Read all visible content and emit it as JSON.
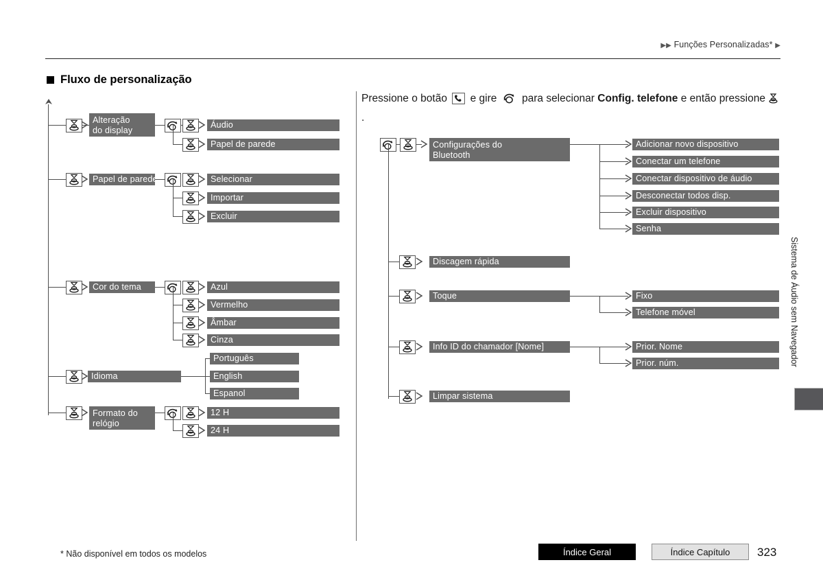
{
  "header": {
    "breadcrumb": "Funções Personalizadas*",
    "triangles": "▶▶",
    "triangle_end": "▶"
  },
  "section": {
    "title": "Fluxo de personalização"
  },
  "side_tab_label": "Sistema de Áudio sem Navegador",
  "footer": {
    "footnote": "* Não disponível em todos os modelos",
    "index_general": "Índice Geral",
    "index_chapter": "Índice Capítulo",
    "page_number": "323"
  },
  "instruction": {
    "part1": "Pressione o botão",
    "part2": "e gire",
    "part3": "para selecionar",
    "bold": "Config. telefone",
    "part4": "e então",
    "part5": "pressione",
    "period": "."
  },
  "icons": {
    "knob_rotate": "rotary-knob-icon",
    "knob_press": "press-knob-icon",
    "phone": "phone-handset-icon"
  },
  "colors": {
    "bar": "#6b6b6b",
    "line": "#4d4d4d",
    "tab": "#57575a",
    "index_general_bg": "#000000",
    "index_chapter_bg": "#e2e2e2"
  },
  "left_tree": [
    {
      "label_lines": [
        "Alteração",
        "do display"
      ],
      "children": [
        "Áudio",
        "Papel de parede"
      ]
    },
    {
      "label_lines": [
        "Papel de parede"
      ],
      "children": [
        "Selecionar",
        "Importar",
        "Excluir"
      ]
    },
    {
      "label_lines": [
        "Cor do tema"
      ],
      "children": [
        "Azul",
        "Vermelho",
        "Âmbar",
        "Cinza"
      ]
    },
    {
      "label_lines": [
        "Idioma"
      ],
      "children": [
        "Português",
        "English",
        "Espanol"
      ]
    },
    {
      "label_lines": [
        "Formato do",
        "relógio"
      ],
      "children": [
        "12 H",
        "24 H"
      ]
    }
  ],
  "right_tree": [
    {
      "label_lines": [
        "Configurações do",
        "Bluetooth"
      ],
      "children": [
        "Adicionar novo dispositivo",
        "Conectar um telefone",
        "Conectar dispositivo de áudio",
        "Desconectar todos disp.",
        "Excluir dispositivo",
        "Senha"
      ]
    },
    {
      "label_lines": [
        "Discagem rápida"
      ],
      "children": []
    },
    {
      "label_lines": [
        "Toque"
      ],
      "children": [
        "Fixo",
        "Telefone móvel"
      ]
    },
    {
      "label_lines": [
        "Info ID do chamador [Nome]"
      ],
      "children": [
        "Prior. Nome",
        "Prior. núm."
      ]
    },
    {
      "label_lines": [
        "Limpar sistema"
      ],
      "children": []
    }
  ]
}
